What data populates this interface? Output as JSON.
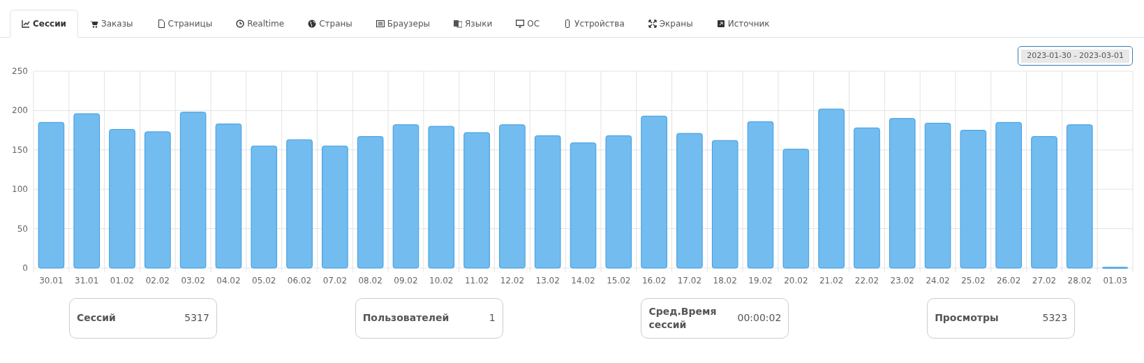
{
  "tabs": [
    {
      "label": "Сессии",
      "selected": true
    },
    {
      "label": "Заказы",
      "selected": false
    },
    {
      "label": "Страницы",
      "selected": false
    },
    {
      "label": "Realtime",
      "selected": false
    },
    {
      "label": "Страны",
      "selected": false
    },
    {
      "label": "Браузеры",
      "selected": false
    },
    {
      "label": "Языки",
      "selected": false
    },
    {
      "label": "ОС",
      "selected": false
    },
    {
      "label": "Устройства",
      "selected": false
    },
    {
      "label": "Экраны",
      "selected": false
    },
    {
      "label": "Источник",
      "selected": false
    }
  ],
  "date_range": "2023-01-30 - 2023-03-01",
  "chart_data": {
    "type": "bar",
    "categories": [
      "30.01",
      "31.01",
      "01.02",
      "02.02",
      "03.02",
      "04.02",
      "05.02",
      "06.02",
      "07.02",
      "08.02",
      "09.02",
      "10.02",
      "11.02",
      "12.02",
      "13.02",
      "14.02",
      "15.02",
      "16.02",
      "17.02",
      "18.02",
      "19.02",
      "20.02",
      "21.02",
      "22.02",
      "23.02",
      "24.02",
      "25.02",
      "26.02",
      "27.02",
      "28.02",
      "01.03"
    ],
    "grid": true,
    "series": [
      {
        "color": "#72bcf0",
        "values": [
          185,
          196,
          176,
          173,
          198,
          183,
          155,
          163,
          155,
          167,
          182,
          180,
          172,
          182,
          168,
          159,
          168,
          193,
          171,
          162,
          186,
          151,
          202,
          178,
          190,
          184,
          175,
          185,
          167,
          182,
          1
        ]
      }
    ],
    "ylim": [
      0,
      250
    ],
    "yticks": [
      0,
      50,
      100,
      150,
      200,
      250
    ]
  },
  "stats": [
    {
      "label": "Сессий",
      "value": "5317"
    },
    {
      "label": "Пользователей",
      "value": "1"
    },
    {
      "label": "Сред.Время сессий",
      "value": "00:00:02"
    },
    {
      "label": "Просмотры",
      "value": "5323"
    }
  ]
}
